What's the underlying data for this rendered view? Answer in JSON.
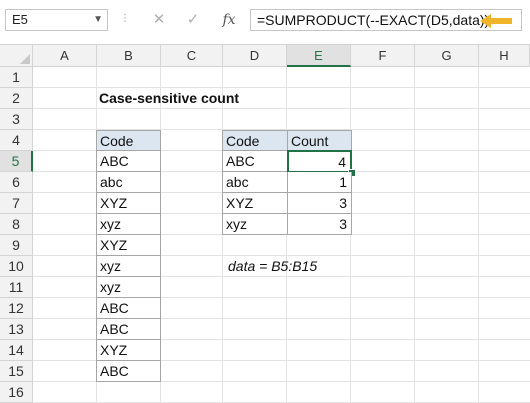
{
  "toolbar": {
    "name_box": "E5",
    "name_box_dropdown_icon": "chevron-down-icon",
    "cancel_icon": "close-icon",
    "enter_icon": "checkmark-icon",
    "fx_label": "fx",
    "formula": "=SUMPRODUCT(--EXACT(D5,data))",
    "arrow_color": "#f0b428"
  },
  "columns": [
    "A",
    "B",
    "C",
    "D",
    "E",
    "F",
    "G",
    "H"
  ],
  "rows": [
    "1",
    "2",
    "3",
    "4",
    "5",
    "6",
    "7",
    "8",
    "9",
    "10",
    "11",
    "12",
    "13",
    "14",
    "15",
    "16"
  ],
  "active_cell": {
    "column": "E",
    "row": "5"
  },
  "sheet": {
    "title": "Case-sensitive count",
    "data_table": {
      "header": "Code",
      "values": [
        "ABC",
        "abc",
        "XYZ",
        "xyz",
        "XYZ",
        "xyz",
        "xyz",
        "ABC",
        "ABC",
        "XYZ",
        "ABC"
      ]
    },
    "count_table": {
      "headers": [
        "Code",
        "Count"
      ],
      "rows": [
        {
          "code": "ABC",
          "count": "4"
        },
        {
          "code": "abc",
          "count": "1"
        },
        {
          "code": "XYZ",
          "count": "3"
        },
        {
          "code": "xyz",
          "count": "3"
        }
      ]
    },
    "note": "data = B5:B15"
  },
  "colors": {
    "header_fill": "#dce6f1",
    "selection": "#217346",
    "border": "#a6a6a6"
  }
}
